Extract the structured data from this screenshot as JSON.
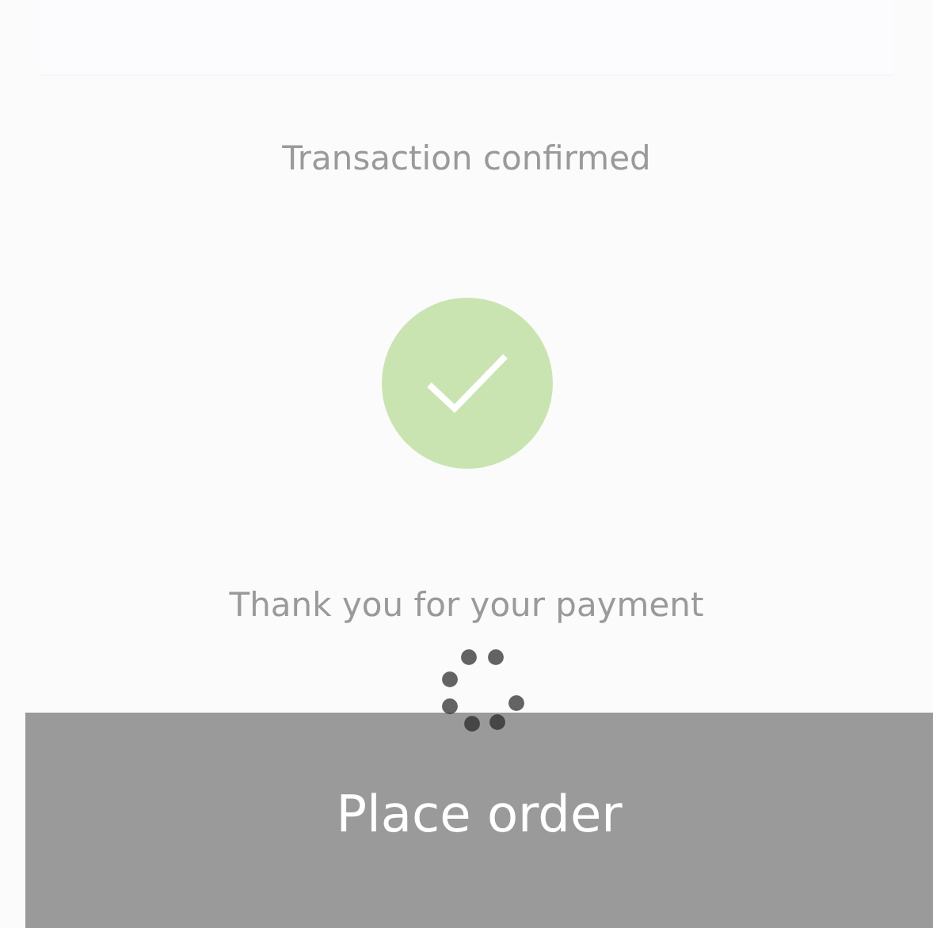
{
  "title": "Transaction confirmed",
  "status": {
    "kind": "success"
  },
  "message": "Thank you for your payment",
  "order_button": {
    "label": "Place order",
    "loading": true
  }
}
